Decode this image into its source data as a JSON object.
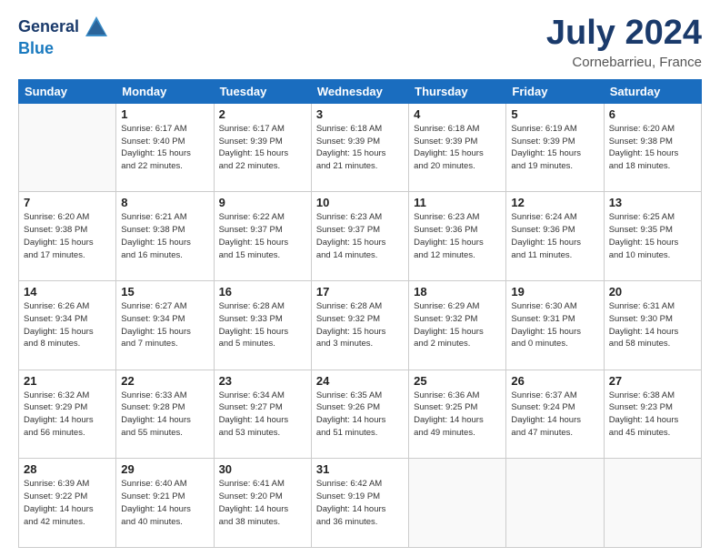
{
  "logo": {
    "line1": "General",
    "line2": "Blue"
  },
  "title": "July 2024",
  "subtitle": "Cornebarrieu, France",
  "days_header": [
    "Sunday",
    "Monday",
    "Tuesday",
    "Wednesday",
    "Thursday",
    "Friday",
    "Saturday"
  ],
  "weeks": [
    [
      {
        "day": "",
        "info": ""
      },
      {
        "day": "1",
        "info": "Sunrise: 6:17 AM\nSunset: 9:40 PM\nDaylight: 15 hours\nand 22 minutes."
      },
      {
        "day": "2",
        "info": "Sunrise: 6:17 AM\nSunset: 9:39 PM\nDaylight: 15 hours\nand 22 minutes."
      },
      {
        "day": "3",
        "info": "Sunrise: 6:18 AM\nSunset: 9:39 PM\nDaylight: 15 hours\nand 21 minutes."
      },
      {
        "day": "4",
        "info": "Sunrise: 6:18 AM\nSunset: 9:39 PM\nDaylight: 15 hours\nand 20 minutes."
      },
      {
        "day": "5",
        "info": "Sunrise: 6:19 AM\nSunset: 9:39 PM\nDaylight: 15 hours\nand 19 minutes."
      },
      {
        "day": "6",
        "info": "Sunrise: 6:20 AM\nSunset: 9:38 PM\nDaylight: 15 hours\nand 18 minutes."
      }
    ],
    [
      {
        "day": "7",
        "info": "Sunrise: 6:20 AM\nSunset: 9:38 PM\nDaylight: 15 hours\nand 17 minutes."
      },
      {
        "day": "8",
        "info": "Sunrise: 6:21 AM\nSunset: 9:38 PM\nDaylight: 15 hours\nand 16 minutes."
      },
      {
        "day": "9",
        "info": "Sunrise: 6:22 AM\nSunset: 9:37 PM\nDaylight: 15 hours\nand 15 minutes."
      },
      {
        "day": "10",
        "info": "Sunrise: 6:23 AM\nSunset: 9:37 PM\nDaylight: 15 hours\nand 14 minutes."
      },
      {
        "day": "11",
        "info": "Sunrise: 6:23 AM\nSunset: 9:36 PM\nDaylight: 15 hours\nand 12 minutes."
      },
      {
        "day": "12",
        "info": "Sunrise: 6:24 AM\nSunset: 9:36 PM\nDaylight: 15 hours\nand 11 minutes."
      },
      {
        "day": "13",
        "info": "Sunrise: 6:25 AM\nSunset: 9:35 PM\nDaylight: 15 hours\nand 10 minutes."
      }
    ],
    [
      {
        "day": "14",
        "info": "Sunrise: 6:26 AM\nSunset: 9:34 PM\nDaylight: 15 hours\nand 8 minutes."
      },
      {
        "day": "15",
        "info": "Sunrise: 6:27 AM\nSunset: 9:34 PM\nDaylight: 15 hours\nand 7 minutes."
      },
      {
        "day": "16",
        "info": "Sunrise: 6:28 AM\nSunset: 9:33 PM\nDaylight: 15 hours\nand 5 minutes."
      },
      {
        "day": "17",
        "info": "Sunrise: 6:28 AM\nSunset: 9:32 PM\nDaylight: 15 hours\nand 3 minutes."
      },
      {
        "day": "18",
        "info": "Sunrise: 6:29 AM\nSunset: 9:32 PM\nDaylight: 15 hours\nand 2 minutes."
      },
      {
        "day": "19",
        "info": "Sunrise: 6:30 AM\nSunset: 9:31 PM\nDaylight: 15 hours\nand 0 minutes."
      },
      {
        "day": "20",
        "info": "Sunrise: 6:31 AM\nSunset: 9:30 PM\nDaylight: 14 hours\nand 58 minutes."
      }
    ],
    [
      {
        "day": "21",
        "info": "Sunrise: 6:32 AM\nSunset: 9:29 PM\nDaylight: 14 hours\nand 56 minutes."
      },
      {
        "day": "22",
        "info": "Sunrise: 6:33 AM\nSunset: 9:28 PM\nDaylight: 14 hours\nand 55 minutes."
      },
      {
        "day": "23",
        "info": "Sunrise: 6:34 AM\nSunset: 9:27 PM\nDaylight: 14 hours\nand 53 minutes."
      },
      {
        "day": "24",
        "info": "Sunrise: 6:35 AM\nSunset: 9:26 PM\nDaylight: 14 hours\nand 51 minutes."
      },
      {
        "day": "25",
        "info": "Sunrise: 6:36 AM\nSunset: 9:25 PM\nDaylight: 14 hours\nand 49 minutes."
      },
      {
        "day": "26",
        "info": "Sunrise: 6:37 AM\nSunset: 9:24 PM\nDaylight: 14 hours\nand 47 minutes."
      },
      {
        "day": "27",
        "info": "Sunrise: 6:38 AM\nSunset: 9:23 PM\nDaylight: 14 hours\nand 45 minutes."
      }
    ],
    [
      {
        "day": "28",
        "info": "Sunrise: 6:39 AM\nSunset: 9:22 PM\nDaylight: 14 hours\nand 42 minutes."
      },
      {
        "day": "29",
        "info": "Sunrise: 6:40 AM\nSunset: 9:21 PM\nDaylight: 14 hours\nand 40 minutes."
      },
      {
        "day": "30",
        "info": "Sunrise: 6:41 AM\nSunset: 9:20 PM\nDaylight: 14 hours\nand 38 minutes."
      },
      {
        "day": "31",
        "info": "Sunrise: 6:42 AM\nSunset: 9:19 PM\nDaylight: 14 hours\nand 36 minutes."
      },
      {
        "day": "",
        "info": ""
      },
      {
        "day": "",
        "info": ""
      },
      {
        "day": "",
        "info": ""
      }
    ]
  ]
}
